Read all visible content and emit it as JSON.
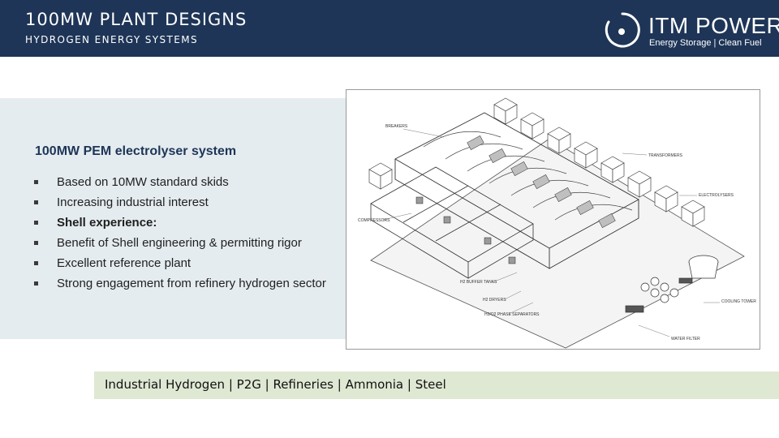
{
  "header": {
    "title": "100MW PLANT DESIGNS",
    "subtitle": "HYDROGEN ENERGY SYSTEMS",
    "background_color": "#1e3557"
  },
  "logo": {
    "name": "ITM POWER",
    "tagline": "Energy Storage | Clean Fuel"
  },
  "panel": {
    "heading": "100MW PEM electrolyser system",
    "bullets": [
      {
        "text": "Based on 10MW standard skids",
        "bold": false
      },
      {
        "text": "Increasing industrial interest",
        "bold": false
      },
      {
        "text": "Shell experience:",
        "bold": true
      },
      {
        "text": "Benefit of Shell engineering & permitting rigor",
        "bold": false
      },
      {
        "text": "Excellent reference plant",
        "bold": false
      },
      {
        "text": "Strong engagement from refinery hydrogen sector",
        "bold": false
      }
    ],
    "background_color": "#e4ecef"
  },
  "diagram": {
    "icon": "plant-layout-drawing",
    "labels": {
      "breakers": "BREAKERS",
      "transformers": "TRANSFORMERS",
      "electrolysers": "ELECTROLYSERS",
      "compressors": "COMPRESSORS",
      "h2_buffer_tanks": "H2 BUFFER TANKS",
      "h2_dryers": "H2 DRYERS",
      "separators": "H2/O2 PHASE SEPARATORS",
      "cooling_tower": "COOLING TOWER",
      "water_filter": "WATER FILTER"
    }
  },
  "footer": {
    "text": "Industrial Hydrogen | P2G | Refineries | Ammonia | Steel",
    "background_color": "#dfe8d3"
  }
}
